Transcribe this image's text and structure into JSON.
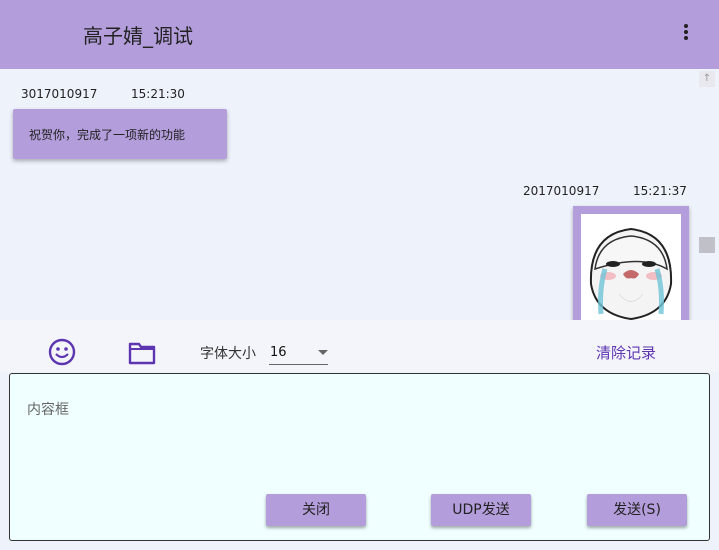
{
  "window": {
    "title": "高子婧_调试"
  },
  "messages": [
    {
      "sender": "3017010917",
      "time": "15:21:30",
      "text": "祝贺你，完成了一项新的功能"
    },
    {
      "sender": "2017010917",
      "time": "15:21:37",
      "image": "crying-meme-sticker"
    }
  ],
  "toolbar": {
    "emoji_icon": "smile-icon",
    "file_icon": "folder-icon",
    "font_size_label": "字体大小",
    "font_size_value": "16",
    "clear_label": "清除记录"
  },
  "input": {
    "placeholder": "内容框",
    "buttons": {
      "close": "关闭",
      "udp_send": "UDP发送",
      "send": "发送(S)"
    }
  },
  "colors": {
    "accent": "#b39ddb",
    "link": "#5e35b1",
    "input_bg": "#f0ffff"
  }
}
